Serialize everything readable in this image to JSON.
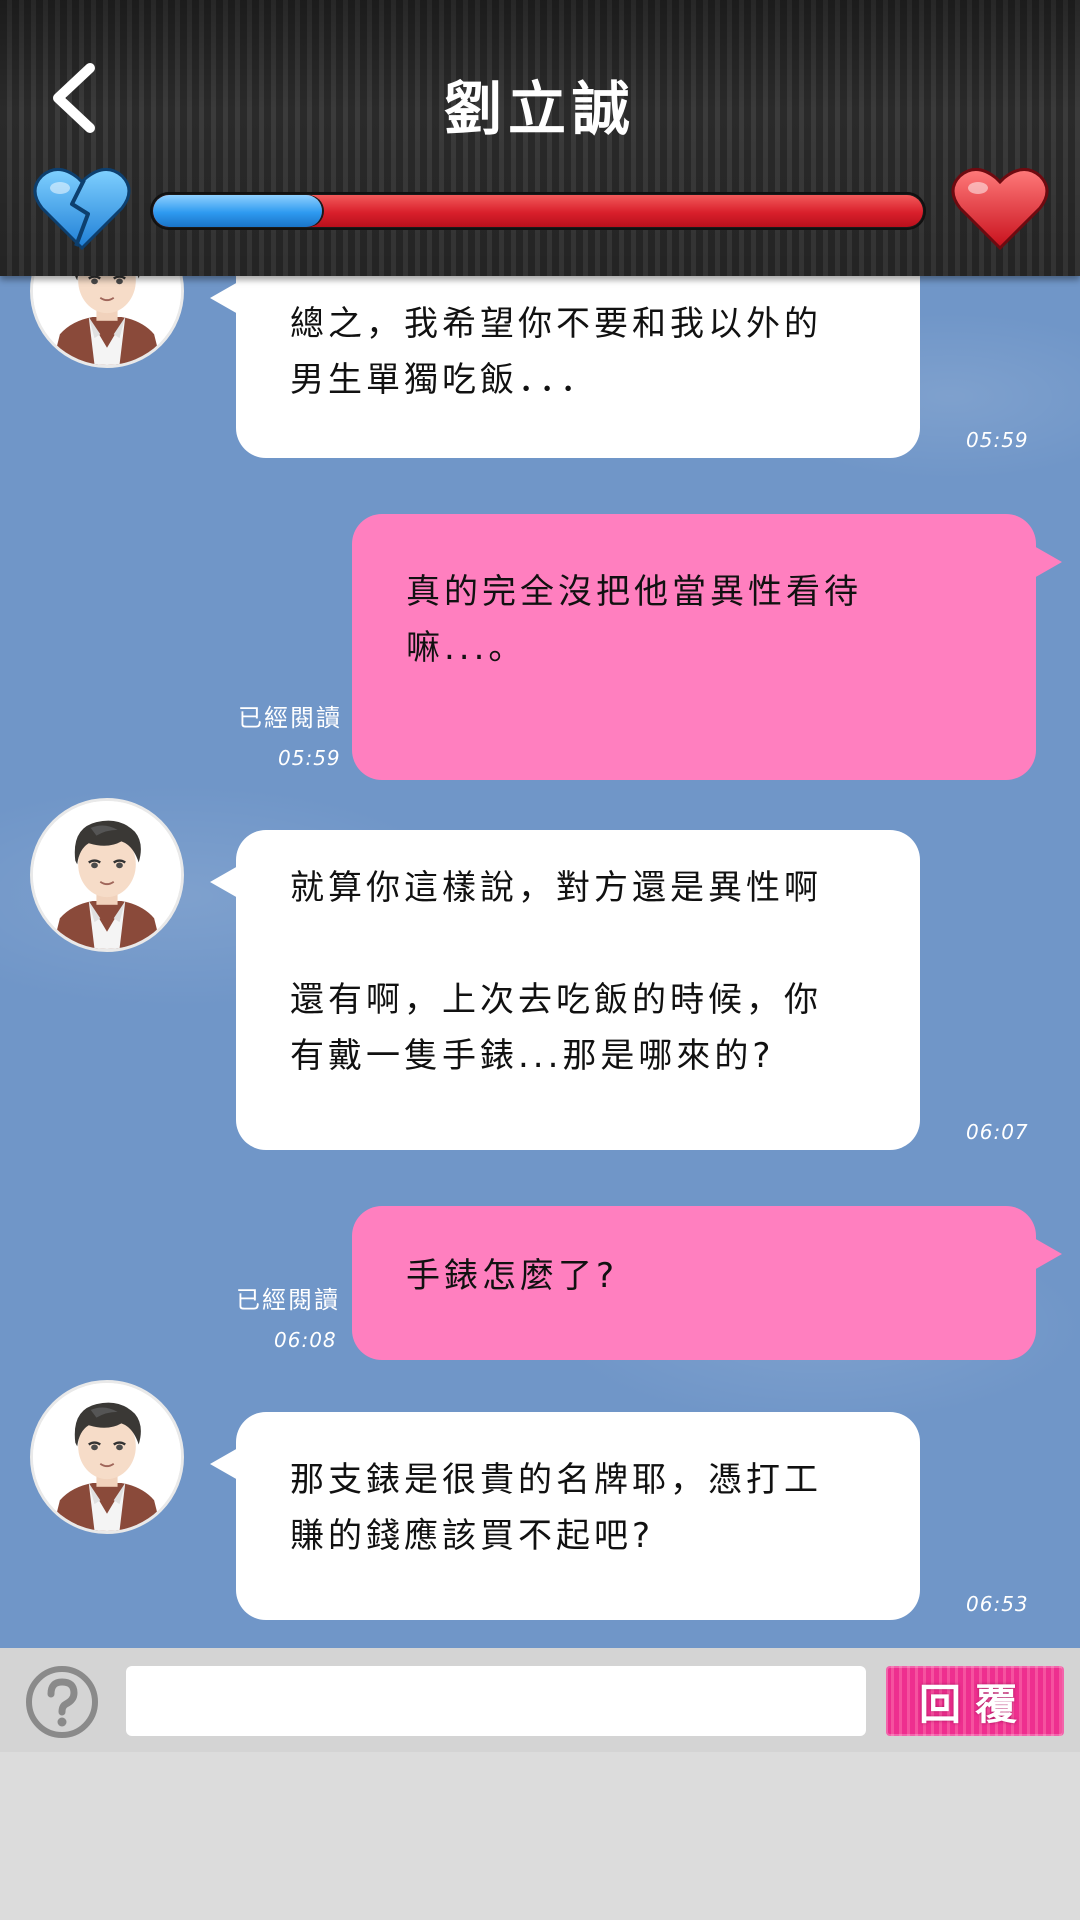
{
  "header": {
    "title": "劉立誠",
    "affection_level": 0.22
  },
  "messages": [
    {
      "id": "m1",
      "side": "in",
      "text": "總之，我希望你不要和我以外的\n男生單獨吃飯．．．",
      "time": "05:59"
    },
    {
      "id": "m2",
      "side": "out",
      "text": "真的完全沒把他當異性看待\n嘛...。",
      "time": "05:59",
      "read": "已經閱讀"
    },
    {
      "id": "m3",
      "side": "in",
      "text": "就算你這樣說，對方還是異性啊\n\n還有啊，上次去吃飯的時候，你\n有戴一隻手錶...那是哪來的?",
      "time": "06:07"
    },
    {
      "id": "m4",
      "side": "out",
      "text": "手錶怎麼了?",
      "time": "06:08",
      "read": "已經閱讀"
    },
    {
      "id": "m5",
      "side": "in",
      "text": "那支錶是很貴的名牌耶，憑打工\n賺的錢應該買不起吧?",
      "time": "06:53"
    }
  ],
  "input": {
    "value": "",
    "reply_label": "回覆"
  },
  "icons": {
    "back": "chevron-left-icon",
    "broken_heart": "broken-heart-icon",
    "heart": "heart-icon",
    "help": "question-circle-icon"
  },
  "colors": {
    "incoming_bubble": "#ffffff",
    "outgoing_bubble": "#ff7fbf",
    "chat_background": "#7096c8",
    "meter_blue": "#2e9af0",
    "meter_red": "#d91f2b",
    "reply_button": "#ee2f8f"
  }
}
